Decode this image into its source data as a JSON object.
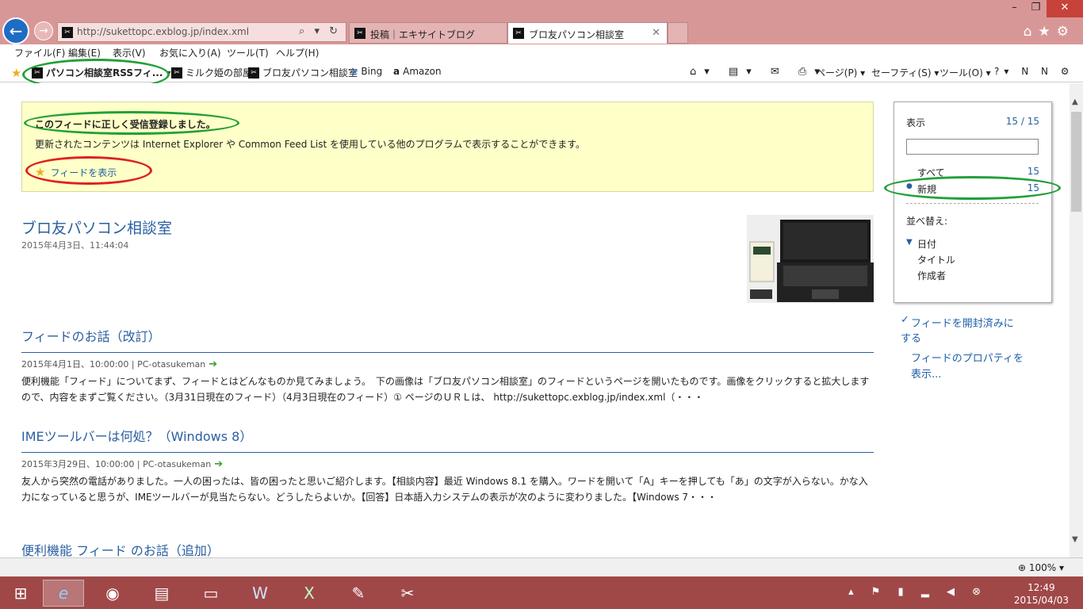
{
  "window": {
    "minimize": "–",
    "maximize": "❐",
    "close": "✕"
  },
  "address": {
    "url": "http://sukettopc.exblog.jp/index.xml",
    "controls": "⌕ ▾ ↻"
  },
  "tabs": [
    {
      "label": "投稿｜エキサイトブログ",
      "active": false
    },
    {
      "label": "ブロ友パソコン相談室",
      "active": true
    }
  ],
  "browser_icons": "⌂★⚙",
  "menu": [
    "ファイル(F)",
    "編集(E)",
    "表示(V)",
    "お気に入り(A)",
    "ツール(T)",
    "ヘルプ(H)"
  ],
  "favorites": {
    "feeds_button": "パソコン相談室RSSフィ...",
    "items": [
      "ミルク姫の部屋",
      "ブロ友パソコン相談室",
      "Bing",
      "Amazon"
    ]
  },
  "command_bar": [
    "ページ(P) ▾",
    "セーフティ(S) ▾",
    "ツール(O) ▾"
  ],
  "banner": {
    "subscribed": "このフィードに正しく受信登録しました。",
    "description": "更新されたコンテンツは Internet Explorer や Common Feed List を使用している他のプログラムで表示することができます。",
    "view_link": "フィードを表示"
  },
  "feed": {
    "title": "ブロ友パソコン相談室",
    "date": "2015年4月3日、11:44:04"
  },
  "articles": [
    {
      "title": "フィードのお話（改訂）",
      "meta": "2015年4月1日、10:00:00 | PC-otasukeman",
      "body": "便利機能「フィード」についてまず、フィードとはどんなものか見てみましょう。　下の画像は「ブロ友パソコン相談室」のフィードというページを開いたものです。画像をクリックすると拡大しますので、内容をまずご覧ください。（3月31日現在のフィード）（4月3日現在のフィード）① ページのＵＲＬは、 http://sukettopc.exblog.jp/index.xml（・・・"
    },
    {
      "title": "IMEツールバーは何処？（Windows 8）",
      "meta": "2015年3月29日、10:00:00 | PC-otasukeman",
      "body": "友人から突然の電話がありました。一人の困ったは、皆の困ったと思いご紹介します。【相談内容】最近 Windows 8.1 を購入。ワードを開いて「A」キーを押しても「あ」の文字が入らない。かな入力になっていると思うが、IMEツールバーが見当たらない。どうしたらよいか。【回答】日本語入力システムの表示が次のように変わりました。【Windows 7・・・"
    },
    {
      "title": "便利機能 フィード のお話（追加）",
      "meta": "",
      "body": ""
    }
  ],
  "sidebar": {
    "display_label": "表示",
    "display_count": "15 / 15",
    "all_label": "すべて",
    "all_count": "15",
    "new_label": "新規",
    "new_count": "15",
    "sort_label": "並べ替え:",
    "sort_options": [
      "日付",
      "タイトル",
      "作成者"
    ],
    "mark_read": "フィードを開封済みに",
    "mark_read2": "する",
    "properties": "フィードのプロパティを",
    "properties2": "表示..."
  },
  "status": {
    "zoom": "100%"
  },
  "clock": {
    "time": "12:49",
    "date": "2015/04/03"
  }
}
